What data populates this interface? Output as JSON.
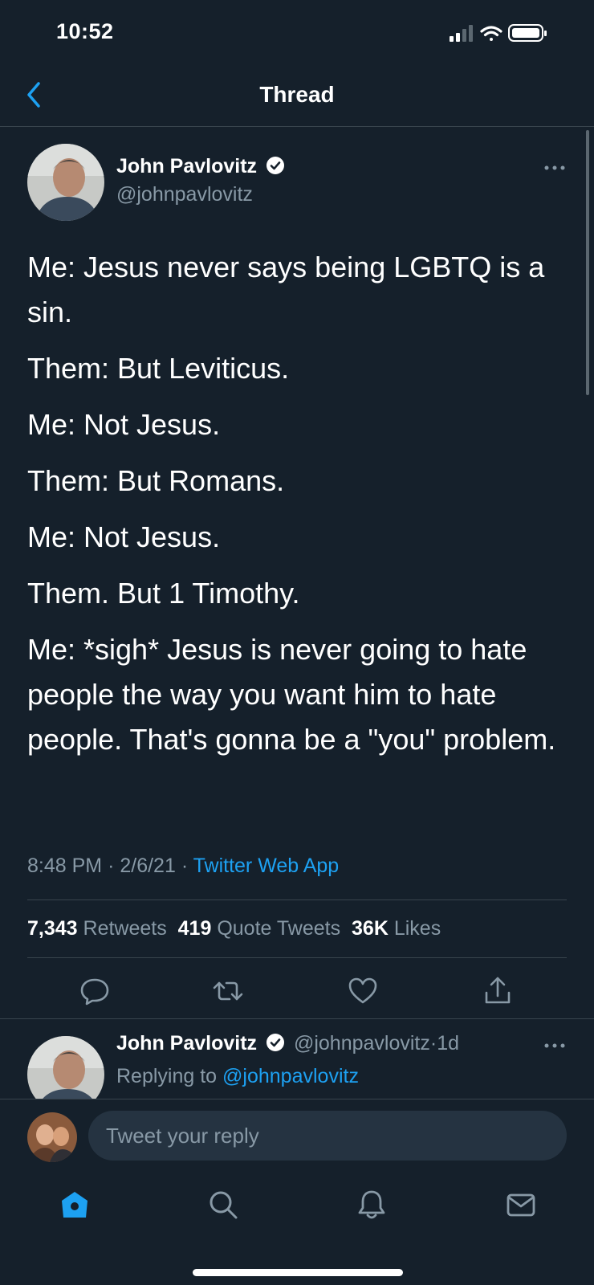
{
  "status_bar": {
    "time": "10:52"
  },
  "header": {
    "title": "Thread"
  },
  "main_tweet": {
    "author_name": "John Pavlovitz",
    "author_handle": "@johnpavlovitz",
    "body": [
      "Me: Jesus never says being LGBTQ is a sin.",
      "Them: But Leviticus.",
      "Me: Not Jesus.",
      "Them: But Romans.",
      "Me: Not Jesus.",
      "Them. But 1 Timothy.",
      "Me: *sigh* Jesus is never going to hate people the way you want him to hate people. That's gonna be a \"you\" problem."
    ],
    "time": "8:48 PM",
    "date": "2/6/21",
    "separator": "·",
    "source": "Twitter Web App",
    "stats": {
      "retweets_count": "7,343",
      "retweets_label": "Retweets",
      "quotes_count": "419",
      "quotes_label": "Quote Tweets",
      "likes_count": "36K",
      "likes_label": "Likes"
    }
  },
  "reply_tweet": {
    "author_name": "John Pavlovitz",
    "author_handle": "@johnpavlovitz",
    "separator": "·",
    "age": "1d",
    "replying_prefix": "Replying to",
    "replying_handle": "@johnpavlovitz"
  },
  "composer": {
    "placeholder": "Tweet your reply"
  },
  "icons": {
    "back": "chevron-left-icon",
    "verified": "verified-badge-icon",
    "more": "more-dots-icon",
    "reply": "comment-icon",
    "retweet": "retweet-icon",
    "like": "heart-icon",
    "share": "share-icon",
    "home": "home-icon",
    "search": "search-icon",
    "notifications": "bell-icon",
    "messages": "mail-icon"
  },
  "colors": {
    "background": "#15202b",
    "accent": "#1da1f2",
    "muted": "#8899a6",
    "divider": "#38444d"
  }
}
